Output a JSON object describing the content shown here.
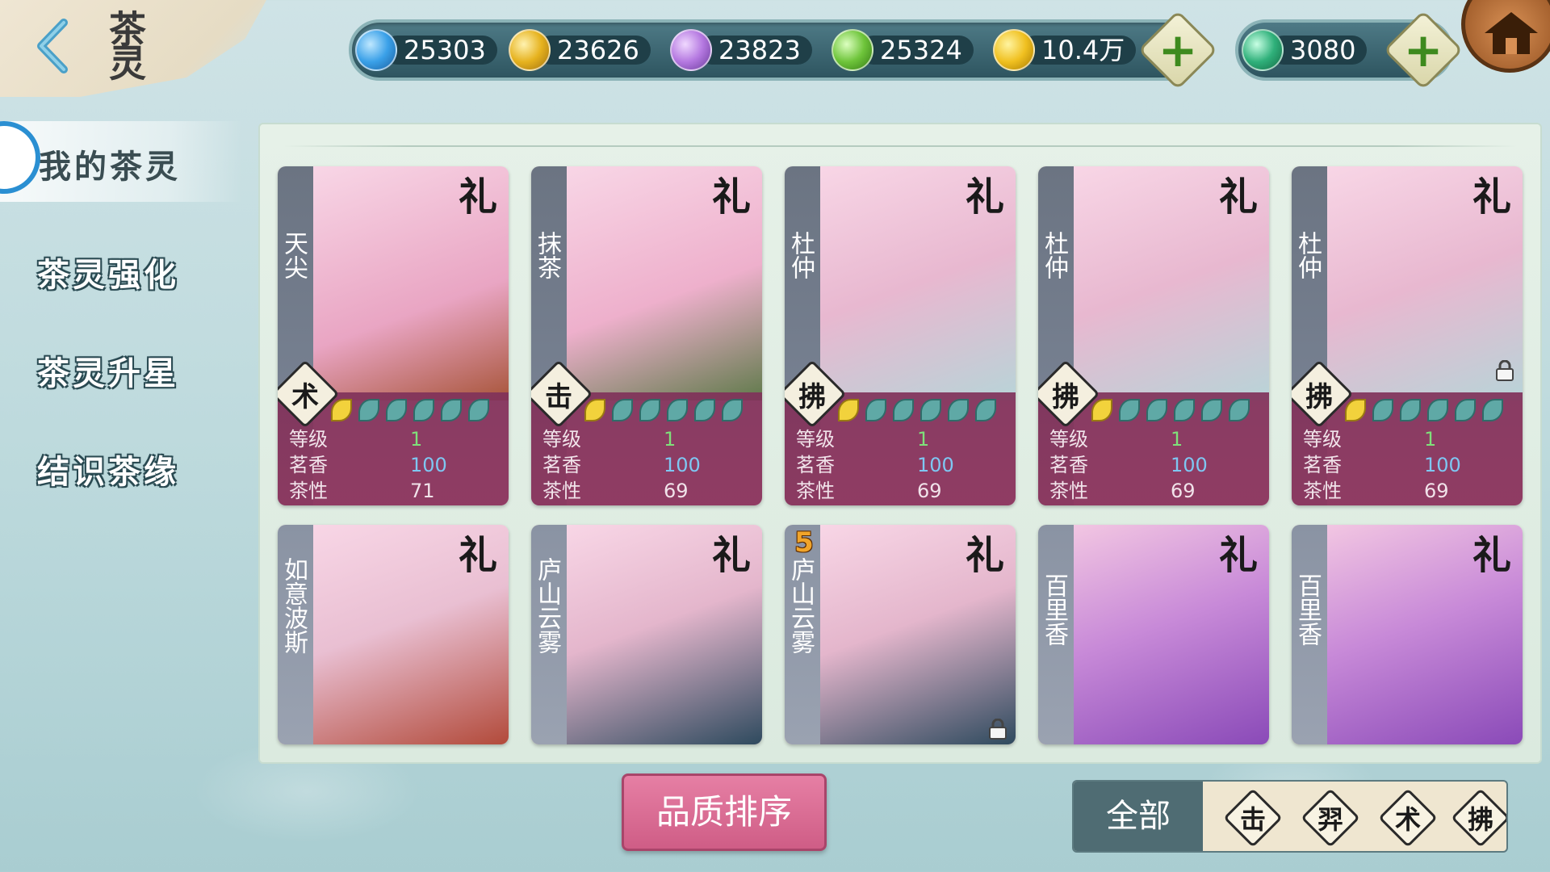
{
  "header": {
    "title": "茶灵",
    "back_icon": "chevron-left-icon",
    "home_icon": "home-icon"
  },
  "resources": [
    {
      "name": "blue-gem",
      "value": "25303",
      "color": "#3aa0e8"
    },
    {
      "name": "gold-gem",
      "value": "23626",
      "color": "#e6b21e"
    },
    {
      "name": "purple-gem",
      "value": "23823",
      "color": "#b478e0"
    },
    {
      "name": "green-gem",
      "value": "25324",
      "color": "#6ec43a"
    },
    {
      "name": "gold-coin",
      "value": "10.4万",
      "color": "#f0c020"
    }
  ],
  "premium": {
    "name": "jade",
    "value": "3080",
    "color": "#2fb07a"
  },
  "nav": {
    "items": [
      {
        "label": "我的茶灵",
        "active": true
      },
      {
        "label": "茶灵强化",
        "active": false
      },
      {
        "label": "茶灵升星",
        "active": false
      },
      {
        "label": "结识茶缘",
        "active": false
      }
    ]
  },
  "stat_labels": {
    "level": "等级",
    "fragrance": "茗香",
    "nature": "茶性"
  },
  "cards_row1": [
    {
      "name": "天尖",
      "rank": "礼",
      "type": "术",
      "level": "1",
      "fragrance": "100",
      "nature": "71",
      "locked": false
    },
    {
      "name": "抹茶",
      "rank": "礼",
      "type": "击",
      "level": "1",
      "fragrance": "100",
      "nature": "69",
      "locked": false
    },
    {
      "name": "杜仲",
      "rank": "礼",
      "type": "拂",
      "level": "1",
      "fragrance": "100",
      "nature": "69",
      "locked": false
    },
    {
      "name": "杜仲",
      "rank": "礼",
      "type": "拂",
      "level": "1",
      "fragrance": "100",
      "nature": "69",
      "locked": false
    },
    {
      "name": "杜仲",
      "rank": "礼",
      "type": "拂",
      "level": "1",
      "fragrance": "100",
      "nature": "69",
      "locked": true
    }
  ],
  "cards_row2": [
    {
      "name": "如意波斯",
      "rank": "礼",
      "star": "",
      "locked": false
    },
    {
      "name": "庐山云雾",
      "rank": "礼",
      "star": "",
      "locked": false
    },
    {
      "name": "庐山云雾",
      "rank": "礼",
      "star": "5",
      "locked": true
    },
    {
      "name": "百里香",
      "rank": "礼",
      "star": "",
      "locked": false
    },
    {
      "name": "百里香",
      "rank": "礼",
      "star": "",
      "locked": false
    }
  ],
  "bottom": {
    "sort_label": "品质排序",
    "filter_all": "全部",
    "filters": [
      "击",
      "羿",
      "术",
      "拂"
    ]
  },
  "colors": {
    "card_pink": "#f1b8d2",
    "stats_bg": "#8a3a60",
    "accent_blue": "#2a8fd2",
    "sort_pink": "#cf5d86"
  }
}
